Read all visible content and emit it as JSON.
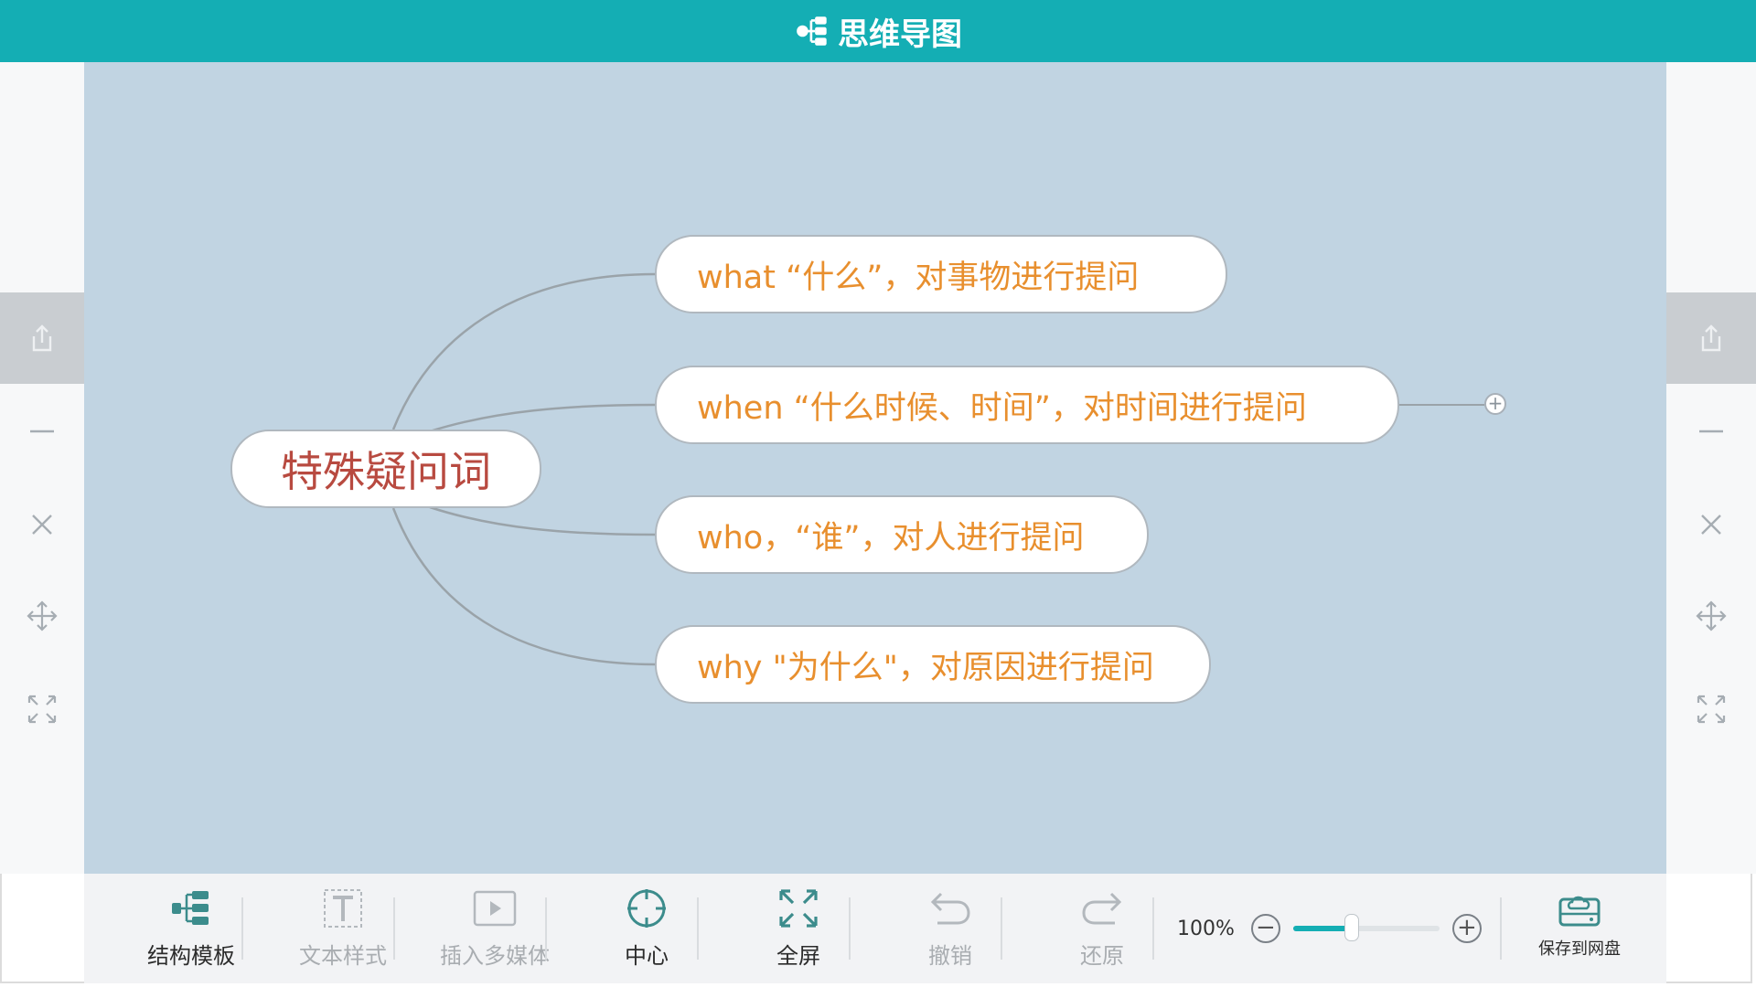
{
  "app": {
    "title": "思维导图"
  },
  "side_tools": [
    "share-icon",
    "minus-icon",
    "close-icon",
    "move-icon",
    "fit-icon"
  ],
  "mindmap": {
    "root": "特殊疑问词",
    "children": [
      "what “什么”，对事物进行提问",
      "when “什么时候、时间”，对时间进行提问",
      "who，“谁”，对人进行提问",
      "why \"为什么\"，对原因进行提问"
    ]
  },
  "toolbar": {
    "structure_template": "结构模板",
    "text_style": "文本样式",
    "insert_media": "插入多媒体",
    "center": "中心",
    "fullscreen": "全屏",
    "undo": "撤销",
    "redo": "还原",
    "zoom_label": "100%",
    "zoom_value": 0.4,
    "save_to_drive": "保存到网盘"
  },
  "colors": {
    "title_bar": "#14aeb4",
    "canvas": "#c1d4e2",
    "root_text": "#b84a40",
    "child_text": "#e88f2e",
    "link": "#9aa3a9"
  }
}
